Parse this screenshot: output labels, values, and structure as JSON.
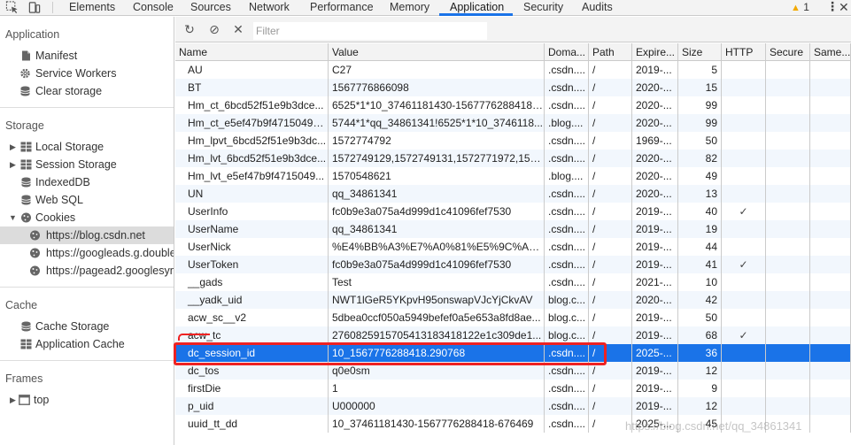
{
  "tabs": [
    {
      "label": "Elements",
      "active": false
    },
    {
      "label": "Console",
      "active": false
    },
    {
      "label": "Sources",
      "active": false
    },
    {
      "label": "Network",
      "active": false
    },
    {
      "label": "Performance",
      "active": false
    },
    {
      "label": "Memory",
      "active": false
    },
    {
      "label": "Application",
      "active": true
    },
    {
      "label": "Security",
      "active": false
    },
    {
      "label": "Audits",
      "active": false
    }
  ],
  "warnings": {
    "count": "1"
  },
  "sidebar": {
    "application_title": "Application",
    "application_items": [
      "Manifest",
      "Service Workers",
      "Clear storage"
    ],
    "storage_title": "Storage",
    "storage_items": [
      "Local Storage",
      "Session Storage",
      "IndexedDB",
      "Web SQL",
      "Cookies"
    ],
    "cookie_items": [
      "https://blog.csdn.net",
      "https://googleads.g.doubleclick.net",
      "https://pagead2.googlesyndication.com"
    ],
    "cache_title": "Cache",
    "cache_items": [
      "Cache Storage",
      "Application Cache"
    ],
    "frames_title": "Frames",
    "frames_items": [
      "top"
    ]
  },
  "toolbar": {
    "filter_placeholder": "Filter",
    "filter_value": ""
  },
  "table": {
    "columns": [
      "Name",
      "Value",
      "Doma...",
      "Path",
      "Expire...",
      "Size",
      "HTTP",
      "Secure",
      "Same..."
    ],
    "rows": [
      {
        "name": "AU",
        "value": "C27",
        "domain": ".csdn....",
        "path": "/",
        "expires": "2019-...",
        "size": "5",
        "http": "",
        "secure": "",
        "same": ""
      },
      {
        "name": "BT",
        "value": "1567776866098",
        "domain": ".csdn....",
        "path": "/",
        "expires": "2020-...",
        "size": "15",
        "http": "",
        "secure": "",
        "same": ""
      },
      {
        "name": "Hm_ct_6bcd52f51e9b3dce...",
        "value": "6525*1*10_37461181430-1567776288418-...",
        "domain": ".csdn....",
        "path": "/",
        "expires": "2020-...",
        "size": "99",
        "http": "",
        "secure": "",
        "same": ""
      },
      {
        "name": "Hm_ct_e5ef47b9f47150495...",
        "value": "5744*1*qq_34861341!6525*1*10_3746118...",
        "domain": ".blog....",
        "path": "/",
        "expires": "2020-...",
        "size": "99",
        "http": "",
        "secure": "",
        "same": ""
      },
      {
        "name": "Hm_lpvt_6bcd52f51e9b3dc...",
        "value": "1572774792",
        "domain": ".csdn....",
        "path": "/",
        "expires": "1969-...",
        "size": "50",
        "http": "",
        "secure": "",
        "same": ""
      },
      {
        "name": "Hm_lvt_6bcd52f51e9b3dce...",
        "value": "1572749129,1572749131,1572771972,157...",
        "domain": ".csdn....",
        "path": "/",
        "expires": "2020-...",
        "size": "82",
        "http": "",
        "secure": "",
        "same": ""
      },
      {
        "name": "Hm_lvt_e5ef47b9f4715049...",
        "value": "1570548621",
        "domain": ".blog....",
        "path": "/",
        "expires": "2020-...",
        "size": "49",
        "http": "",
        "secure": "",
        "same": ""
      },
      {
        "name": "UN",
        "value": "qq_34861341",
        "domain": ".csdn....",
        "path": "/",
        "expires": "2020-...",
        "size": "13",
        "http": "",
        "secure": "",
        "same": ""
      },
      {
        "name": "UserInfo",
        "value": "fc0b9e3a075a4d999d1c41096fef7530",
        "domain": ".csdn....",
        "path": "/",
        "expires": "2019-...",
        "size": "40",
        "http": "✓",
        "secure": "",
        "same": ""
      },
      {
        "name": "UserName",
        "value": "qq_34861341",
        "domain": ".csdn....",
        "path": "/",
        "expires": "2019-...",
        "size": "19",
        "http": "",
        "secure": "",
        "same": ""
      },
      {
        "name": "UserNick",
        "value": "%E4%BB%A3%E7%A0%81%E5%9C%A8%E...",
        "domain": ".csdn....",
        "path": "/",
        "expires": "2019-...",
        "size": "44",
        "http": "",
        "secure": "",
        "same": ""
      },
      {
        "name": "UserToken",
        "value": "fc0b9e3a075a4d999d1c41096fef7530",
        "domain": ".csdn....",
        "path": "/",
        "expires": "2019-...",
        "size": "41",
        "http": "✓",
        "secure": "",
        "same": ""
      },
      {
        "name": "__gads",
        "value": "Test",
        "domain": ".csdn....",
        "path": "/",
        "expires": "2021-...",
        "size": "10",
        "http": "",
        "secure": "",
        "same": ""
      },
      {
        "name": "__yadk_uid",
        "value": "NWT1lGeR5YKpvH95onswapVJcYjCkvAV",
        "domain": "blog.c...",
        "path": "/",
        "expires": "2020-...",
        "size": "42",
        "http": "",
        "secure": "",
        "same": ""
      },
      {
        "name": "acw_sc__v2",
        "value": "5dbea0ccf050a5949befef0a5e653a8fd8ae...",
        "domain": "blog.c...",
        "path": "/",
        "expires": "2019-...",
        "size": "50",
        "http": "",
        "secure": "",
        "same": ""
      },
      {
        "name": "acw_tc",
        "value": "2760825915705413183418122e1c309de1...",
        "domain": "blog.c...",
        "path": "/",
        "expires": "2019-...",
        "size": "68",
        "http": "✓",
        "secure": "",
        "same": ""
      },
      {
        "name": "dc_session_id",
        "value": "10_1567776288418.290768",
        "domain": ".csdn....",
        "path": "/",
        "expires": "2025-...",
        "size": "36",
        "http": "",
        "secure": "",
        "same": ""
      },
      {
        "name": "dc_tos",
        "value": "q0e0sm",
        "domain": ".csdn....",
        "path": "/",
        "expires": "2019-...",
        "size": "12",
        "http": "",
        "secure": "",
        "same": ""
      },
      {
        "name": "firstDie",
        "value": "1",
        "domain": ".csdn....",
        "path": "/",
        "expires": "2019-...",
        "size": "9",
        "http": "",
        "secure": "",
        "same": ""
      },
      {
        "name": "p_uid",
        "value": "U000000",
        "domain": ".csdn....",
        "path": "/",
        "expires": "2019-...",
        "size": "12",
        "http": "",
        "secure": "",
        "same": ""
      },
      {
        "name": "uuid_tt_dd",
        "value": "10_37461181430-1567776288418-676469",
        "domain": ".csdn....",
        "path": "/",
        "expires": "2025-...",
        "size": "45",
        "http": "",
        "secure": "",
        "same": ""
      }
    ],
    "selected_index": 16
  },
  "watermark": "https://blog.csdn.net/qq_34861341",
  "colors": {
    "selection": "#1a73e8",
    "highlight_box": "#ee2222",
    "row_alt": "#f2f7fd"
  }
}
